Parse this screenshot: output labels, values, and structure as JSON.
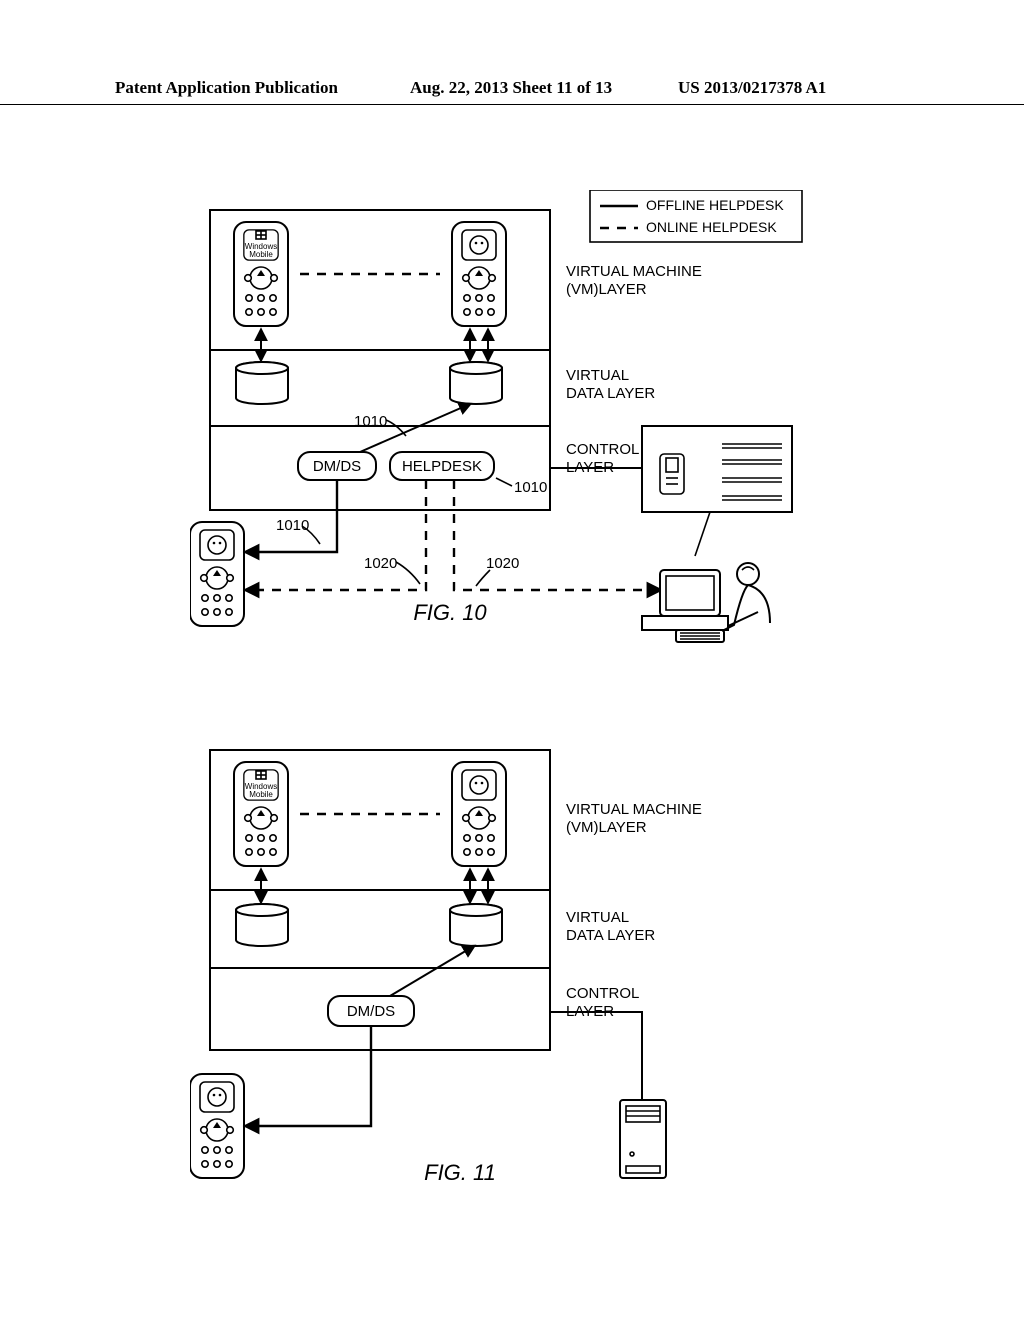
{
  "header": {
    "left": "Patent Application Publication",
    "mid": "Aug. 22, 2013  Sheet 11 of 13",
    "right": "US 2013/0217378 A1"
  },
  "legend": {
    "offline": "OFFLINE HELPDESK",
    "online": "ONLINE HELPDESK"
  },
  "layers": {
    "vm": "VIRTUAL MACHINE\n(VM)LAYER",
    "data": "VIRTUAL\nDATA LAYER",
    "ctrl": "CONTROL\nLAYER"
  },
  "buttons": {
    "dmds": "DM/DS",
    "helpdesk": "HELPDESK"
  },
  "phone_os": {
    "windows": "Windows\nMobile"
  },
  "refs": {
    "r1010": "1010",
    "r1020": "1020"
  },
  "fig10": "FIG. 10",
  "fig11": "FIG. 11"
}
